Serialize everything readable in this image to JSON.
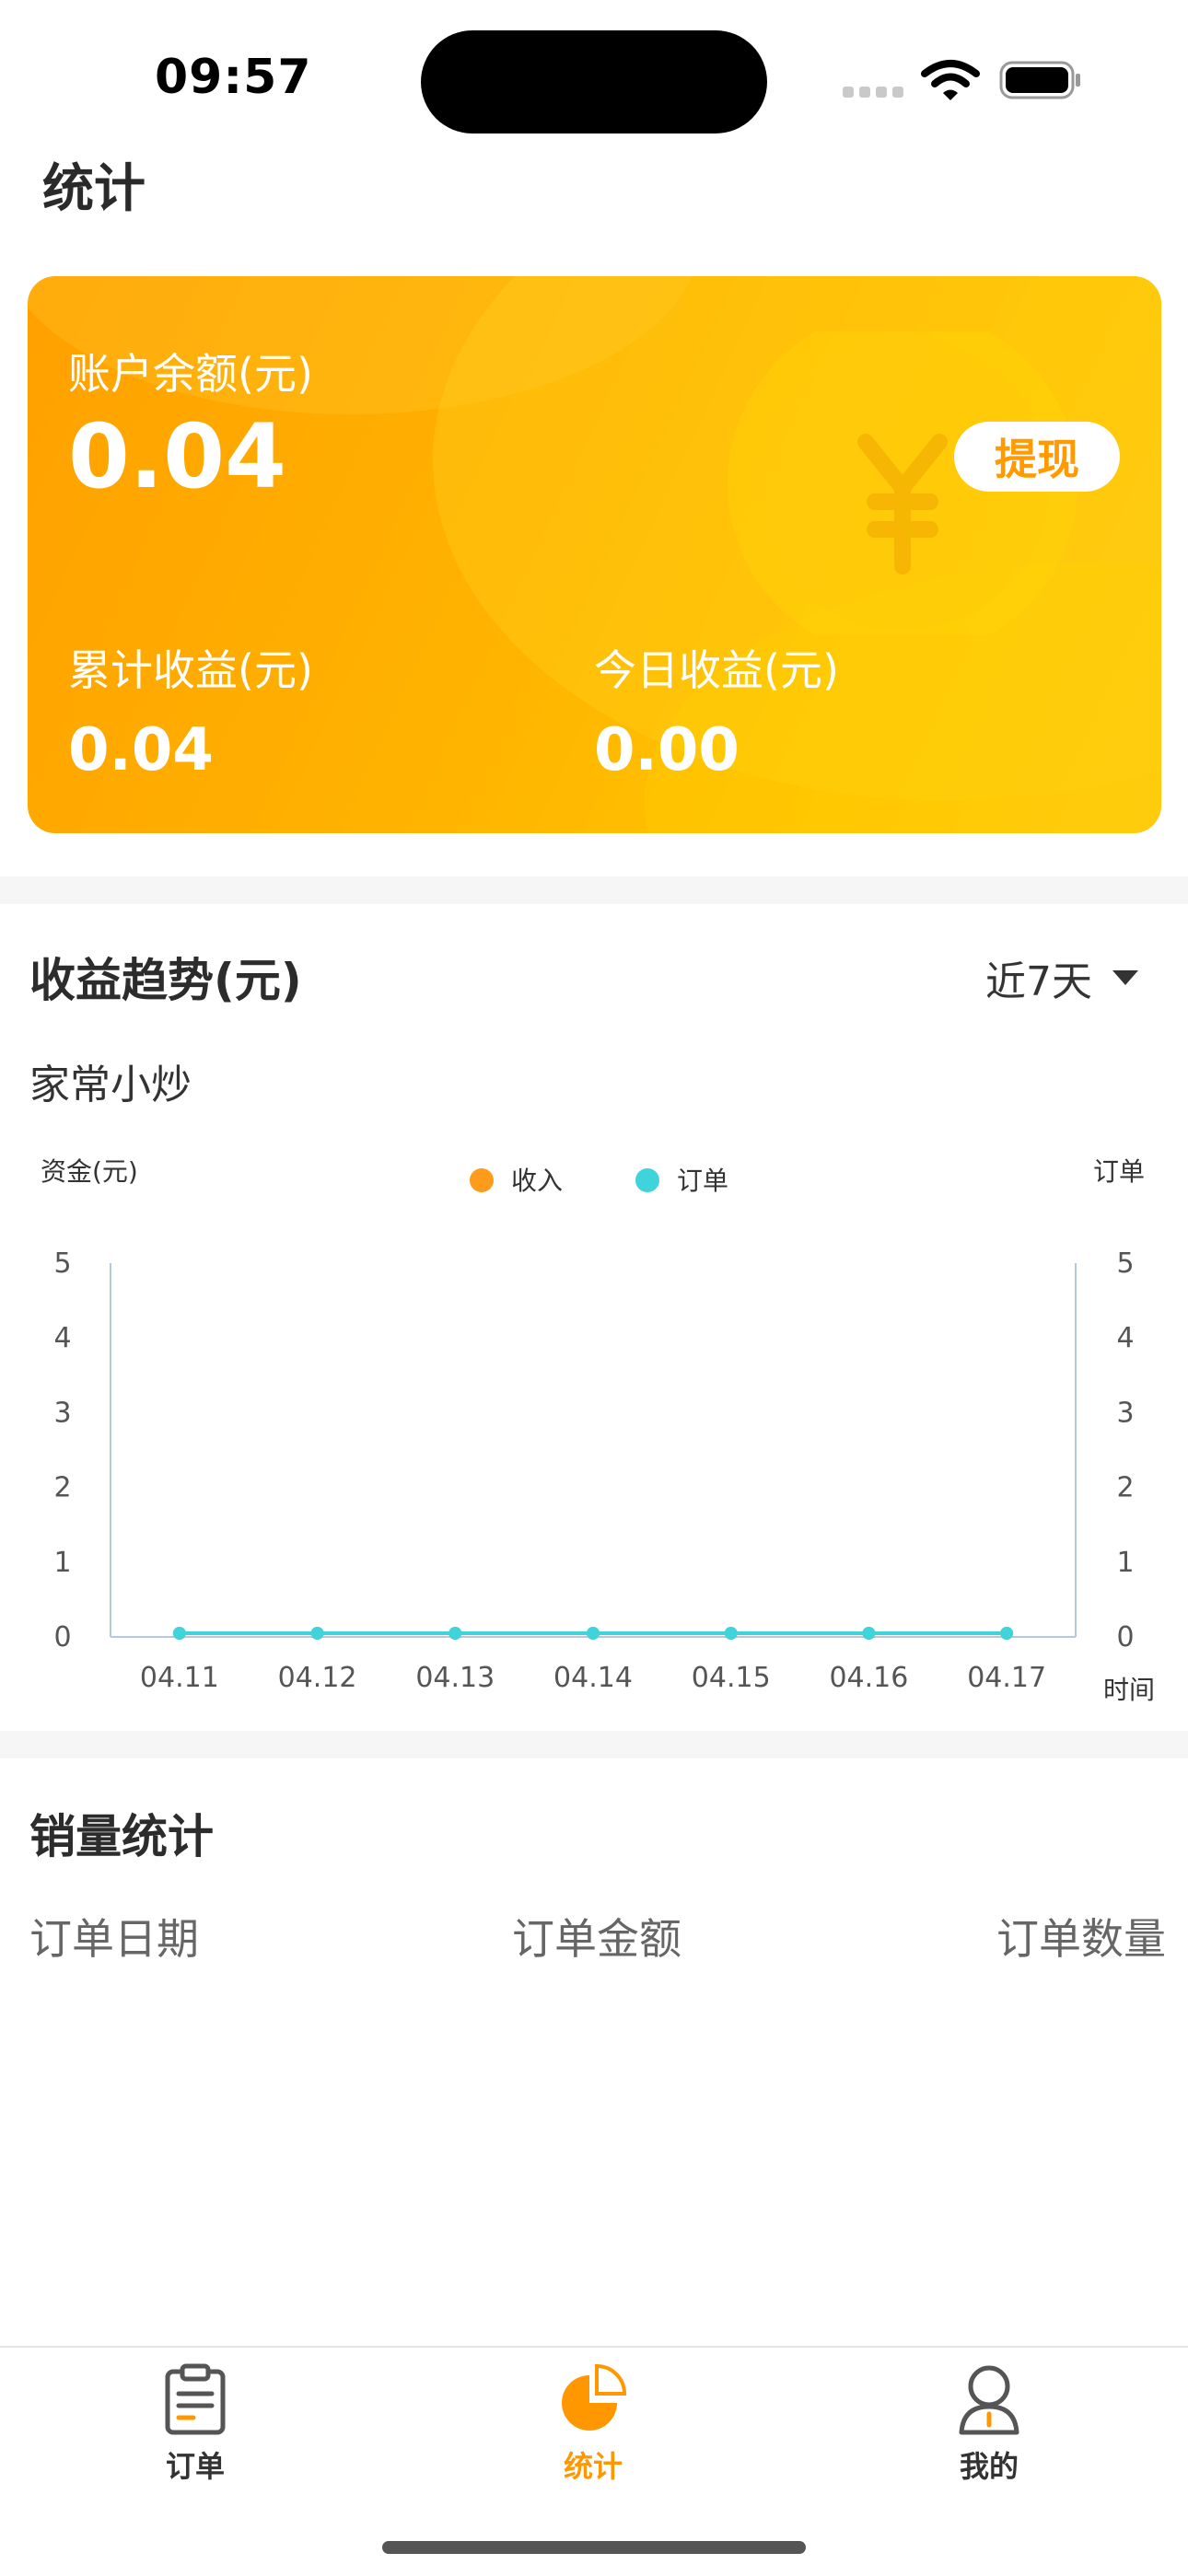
{
  "status_bar": {
    "time": "09:57"
  },
  "page": {
    "title": "统计"
  },
  "card": {
    "balance_label": "账户余额(元)",
    "balance_value": "0.04",
    "withdraw_label": "提现",
    "total_label": "累计收益(元)",
    "total_value": "0.04",
    "today_label": "今日收益(元)",
    "today_value": "0.00"
  },
  "trend": {
    "title": "收益趋势(元)",
    "range_label": "近7天",
    "shop_name": "家常小炒"
  },
  "chart_data": {
    "type": "line",
    "categories": [
      "04.11",
      "04.12",
      "04.13",
      "04.14",
      "04.15",
      "04.16",
      "04.17"
    ],
    "series": [
      {
        "name": "收入",
        "values": [
          0,
          0,
          0,
          0,
          0,
          0,
          0
        ],
        "color": "#ff9b1a"
      },
      {
        "name": "订单",
        "values": [
          0,
          0,
          0,
          0,
          0,
          0,
          0
        ],
        "color": "#3fd4dc"
      }
    ],
    "ylabel": "资金(元)",
    "y2label": "订单",
    "xlabel": "时间",
    "ylim": [
      0,
      5
    ],
    "y2lim": [
      0,
      5
    ],
    "yticks": [
      "0",
      "1",
      "2",
      "3",
      "4",
      "5"
    ],
    "legend_position": "top-center",
    "grid": false
  },
  "sales": {
    "title": "销量统计",
    "columns": [
      "订单日期",
      "订单金额",
      "订单数量"
    ]
  },
  "tab_bar": {
    "items": [
      {
        "label": "订单",
        "icon": "clipboard-icon"
      },
      {
        "label": "统计",
        "icon": "pie-chart-icon",
        "active": true
      },
      {
        "label": "我的",
        "icon": "user-icon"
      }
    ],
    "active_color": "#ff9800"
  }
}
